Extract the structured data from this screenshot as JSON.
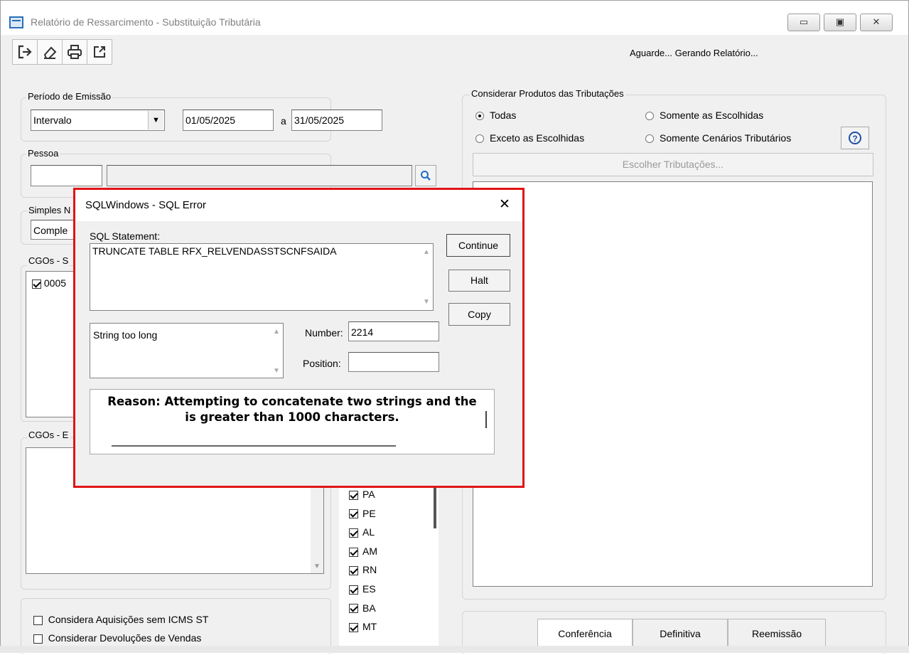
{
  "window": {
    "title": "Relatório de Ressarcimento - Substituição Tributária",
    "status": "Aguarde... Gerando Relatório...",
    "controls": {
      "minimize": "▭",
      "maximize": "▣",
      "close": "✕"
    }
  },
  "toolbar": {
    "icons": [
      "exit-icon",
      "eraser-icon",
      "printer-icon",
      "export-icon"
    ]
  },
  "periodo": {
    "label": "Período de Emissão",
    "select_value": "Intervalo",
    "date_from": "01/05/2025",
    "separator": "a",
    "date_to": "31/05/2025"
  },
  "pessoa": {
    "label": "Pessoa",
    "code": "",
    "name": ""
  },
  "simples": {
    "label": "Simples N",
    "value": "Comple"
  },
  "cgos_s": {
    "label": "CGOs - S",
    "items": [
      {
        "value": "0005",
        "checked": true
      }
    ]
  },
  "cgos_e": {
    "label": "CGOs - E"
  },
  "ufs": {
    "items": [
      {
        "label": "PA",
        "checked": true
      },
      {
        "label": "PE",
        "checked": true
      },
      {
        "label": "AL",
        "checked": true
      },
      {
        "label": "AM",
        "checked": true
      },
      {
        "label": "RN",
        "checked": true
      },
      {
        "label": "ES",
        "checked": true
      },
      {
        "label": "BA",
        "checked": true
      },
      {
        "label": "MT",
        "checked": true
      }
    ]
  },
  "options": {
    "aquisicoes": "Considera Aquisições sem ICMS ST",
    "devolucoes": "Considerar Devoluções de Vendas"
  },
  "tributacoes": {
    "label": "Considerar Produtos das Tributações",
    "radio_todas": "Todas",
    "radio_escolhidas": "Somente as Escolhidas",
    "radio_exceto": "Exceto as Escolhidas",
    "radio_cenarios": "Somente Cenários Tributários",
    "choose_button": "Escolher Tributações..."
  },
  "tabs": [
    "Conferência",
    "Definitiva",
    "Reemissão"
  ],
  "dialog": {
    "title": "SQLWindows - SQL Error",
    "statement_label": "SQL Statement:",
    "statement": "TRUNCATE TABLE RFX_RELVENDASSTSCNFSAIDA",
    "error_text": "String too long",
    "number_label": "Number:",
    "number_value": "2214",
    "position_label": "Position:",
    "position_value": "",
    "reason_line1": "Reason: Attempting to concatenate two strings and the",
    "reason_line2": "is greater than 1000 characters.",
    "continue": "Continue",
    "halt": "Halt",
    "copy": "Copy",
    "close": "✕"
  }
}
